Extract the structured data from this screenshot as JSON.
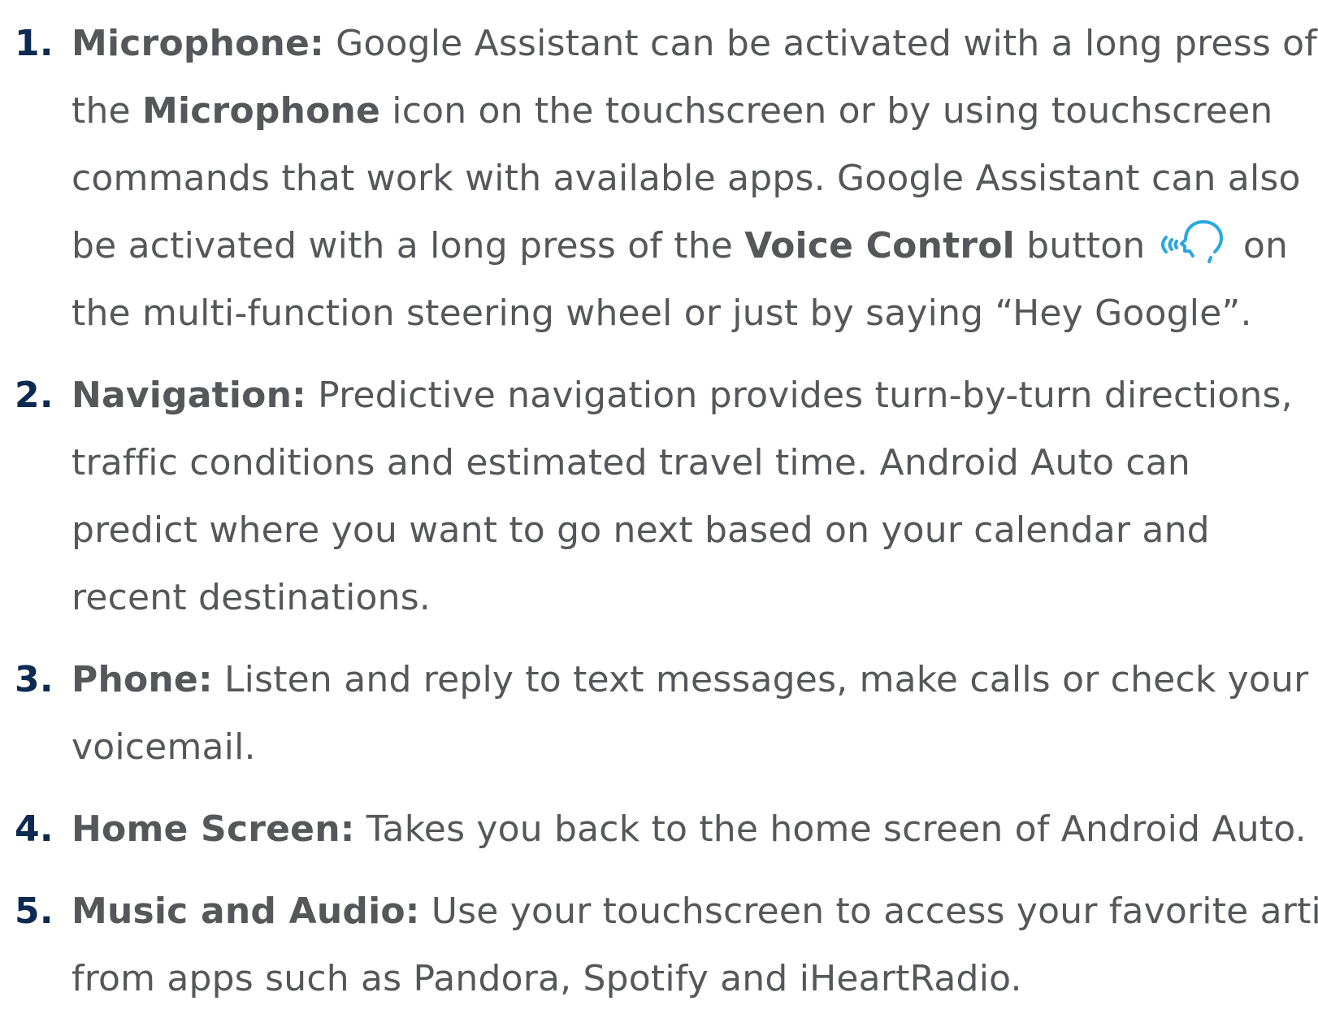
{
  "items": [
    {
      "number": "1.",
      "term": "Microphone:",
      "line1_rest": " Google Assistant can be activated with a long press of",
      "line2_a": "the ",
      "line2_bold": "Microphone",
      "line2_b": " icon on the touchscreen or by using touchscreen",
      "line3": "commands that work with available apps. Google Assistant can also",
      "line4_a": "be activated with a long press of the ",
      "line4_bold": "Voice Control",
      "line4_b": " button ",
      "line4_c": " on",
      "line5": "the multi-function steering wheel or just by saying “Hey Google”."
    },
    {
      "number": "2.",
      "term": "Navigation:",
      "line1_rest": " Predictive navigation provides turn-by-turn directions,",
      "line2": "traffic conditions and estimated travel time. Android Auto can",
      "line3": "predict where you want to go next based on your calendar and",
      "line4": "recent destinations."
    },
    {
      "number": "3.",
      "term": "Phone:",
      "line1_rest": " Listen and reply to text messages, make calls or check your",
      "line2": "voicemail."
    },
    {
      "number": "4.",
      "term": "Home Screen:",
      "line1_rest": " Takes you back to the home screen of Android Auto."
    },
    {
      "number": "5.",
      "term": "Music and Audio:",
      "line1_rest": " Use your touchscreen to access your favorite artists",
      "line2": "from apps such as Pandora, Spotify and iHeartRadio."
    }
  ],
  "icons": {
    "voice_control": "voice-control-icon"
  },
  "colors": {
    "number": "#0d2a52",
    "text": "#55575a",
    "icon": "#29a8e0"
  }
}
